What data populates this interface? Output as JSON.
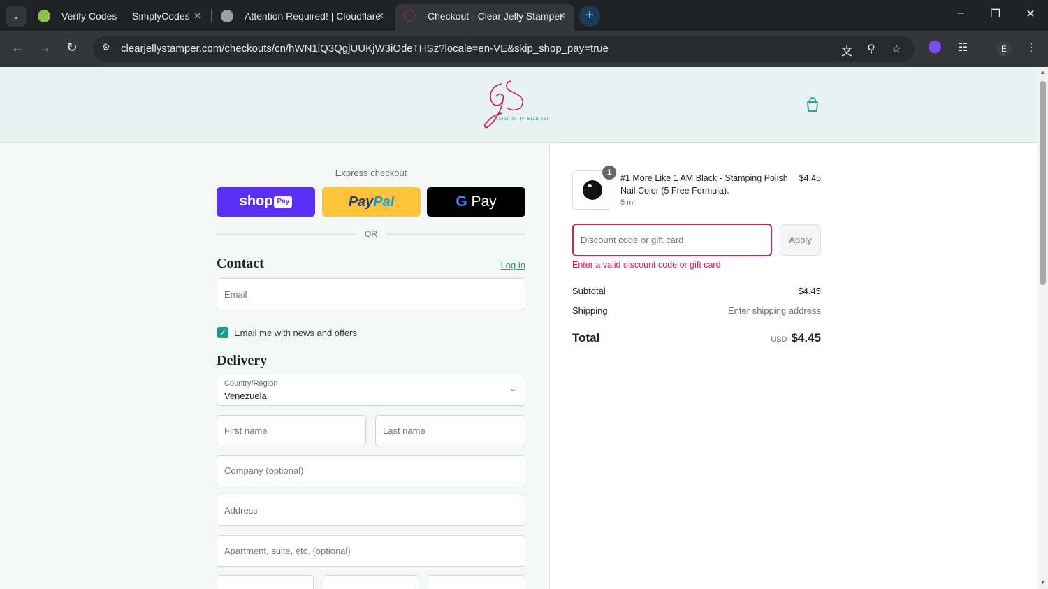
{
  "browser": {
    "tabs": [
      {
        "title": "Verify Codes — SimplyCodes",
        "favicon": "simplycodes-check-icon"
      },
      {
        "title": "Attention Required! | Cloudflare",
        "favicon": "globe-icon"
      },
      {
        "title": "Checkout - Clear Jelly Stamper",
        "favicon": "clear-jelly-stamper-icon",
        "active": true
      }
    ],
    "url": "clearjellystamper.com/checkouts/cn/hWN1iQ3QgjUUKjW3iOdeTHSz?locale=en-VE&skip_shop_pay=true",
    "profile_initial": "E"
  },
  "header": {
    "logo_text": "Clear Jelly Stamper"
  },
  "express": {
    "label": "Express checkout",
    "shop_pay": {
      "shop": "shop",
      "pay": "Pay"
    },
    "paypal": {
      "pay": "Pay",
      "pal": "Pal"
    },
    "gpay": {
      "g": "G",
      "pay": "Pay"
    },
    "or": "OR"
  },
  "contact": {
    "heading": "Contact",
    "login": "Log in",
    "email_placeholder": "Email",
    "news_checkbox_label": "Email me with news and offers",
    "news_checked": true
  },
  "delivery": {
    "heading": "Delivery",
    "country_label": "Country/Region",
    "country_value": "Venezuela",
    "first_name_placeholder": "First name",
    "last_name_placeholder": "Last name",
    "company_placeholder": "Company (optional)",
    "address_placeholder": "Address",
    "apartment_placeholder": "Apartment, suite, etc. (optional)"
  },
  "summary": {
    "item": {
      "name": "#1 More Like 1 AM Black - Stamping Polish Nail Color (5 Free Formula).",
      "variant": "5 ml",
      "quantity": "1",
      "price": "$4.45"
    },
    "discount_placeholder": "Discount code or gift card",
    "apply": "Apply",
    "error": "Enter a valid discount code or gift card",
    "subtotal_label": "Subtotal",
    "subtotal_value": "$4.45",
    "shipping_label": "Shipping",
    "shipping_value": "Enter shipping address",
    "total_label": "Total",
    "currency": "USD",
    "total_value": "$4.45"
  },
  "colors": {
    "accent_teal": "#1a9a8a",
    "error_red": "#d21f5a",
    "header_bg": "#e8f3f1",
    "shop_pay_purple": "#5a31f4",
    "paypal_yellow": "#ffc439"
  }
}
